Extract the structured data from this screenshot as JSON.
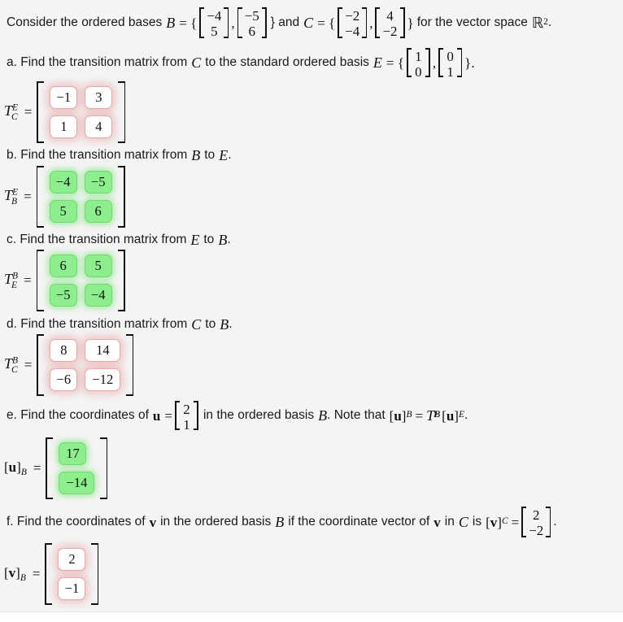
{
  "page": {
    "background_color": "#f4f4f4",
    "below_divider_color": "#ffffff",
    "correct_color": "#8cee8c",
    "incorrect_color": "#ffffff",
    "incorrect_border_color": "#e8a8a8"
  },
  "intro": {
    "text_before_B": "Consider the ordered bases",
    "B_symbol": "B",
    "equals": "= {",
    "B_vectors": [
      {
        "top": "−4",
        "bottom": "5"
      },
      {
        "top": "−5",
        "bottom": "6"
      }
    ],
    "close_and": "} and",
    "C_symbol": "C",
    "C_vectors": [
      {
        "top": "−2",
        "bottom": "−4"
      },
      {
        "top": "4",
        "bottom": "−2"
      }
    ],
    "close_brace": "}",
    "text_after": "for the vector space",
    "space_symbol": "ℝ",
    "space_exponent": "2",
    "period": "."
  },
  "parts": [
    {
      "id": "a",
      "prompt_prefix": "a. Find the transition matrix from",
      "from_symbol": "C",
      "prompt_middle": "to the standard ordered basis",
      "to_symbol": "E",
      "prompt_equals": "= {",
      "E_vectors": [
        {
          "top": "1",
          "bottom": "0"
        },
        {
          "top": "0",
          "bottom": "1"
        }
      ],
      "prompt_suffix": "}.",
      "answer_label_base": "T",
      "answer_label_sup": "E",
      "answer_label_sub": "C",
      "answer_rows": [
        [
          {
            "value": "−1",
            "state": "incorrect"
          },
          {
            "value": "3",
            "state": "incorrect"
          }
        ],
        [
          {
            "value": "1",
            "state": "incorrect"
          },
          {
            "value": "4",
            "state": "incorrect"
          }
        ]
      ]
    },
    {
      "id": "b",
      "prompt_prefix": "b. Find the transition matrix from",
      "from_symbol": "B",
      "prompt_middle": "to",
      "to_symbol": "E",
      "prompt_suffix": ".",
      "answer_label_base": "T",
      "answer_label_sup": "E",
      "answer_label_sub": "B",
      "answer_rows": [
        [
          {
            "value": "−4",
            "state": "correct"
          },
          {
            "value": "−5",
            "state": "correct"
          }
        ],
        [
          {
            "value": "5",
            "state": "correct"
          },
          {
            "value": "6",
            "state": "correct"
          }
        ]
      ]
    },
    {
      "id": "c",
      "prompt_prefix": "c. Find the transition matrix from",
      "from_symbol": "E",
      "prompt_middle": "to",
      "to_symbol": "B",
      "prompt_suffix": ".",
      "answer_label_base": "T",
      "answer_label_sup": "B",
      "answer_label_sub": "E",
      "answer_rows": [
        [
          {
            "value": "6",
            "state": "correct"
          },
          {
            "value": "5",
            "state": "correct"
          }
        ],
        [
          {
            "value": "−5",
            "state": "correct"
          },
          {
            "value": "−4",
            "state": "correct"
          }
        ]
      ]
    },
    {
      "id": "d",
      "prompt_prefix": "d. Find the transition matrix from",
      "from_symbol": "C",
      "prompt_middle": "to",
      "to_symbol": "B",
      "prompt_suffix": ".",
      "answer_label_base": "T",
      "answer_label_sup": "B",
      "answer_label_sub": "C",
      "answer_rows": [
        [
          {
            "value": "8",
            "state": "incorrect"
          },
          {
            "value": "14",
            "state": "incorrect"
          }
        ],
        [
          {
            "value": "−6",
            "state": "incorrect"
          },
          {
            "value": "−12",
            "state": "incorrect"
          }
        ]
      ]
    },
    {
      "id": "e",
      "prompt_prefix": "e. Find the coordinates of",
      "vector_symbol": "u",
      "given_vector": {
        "top": "2",
        "bottom": "1"
      },
      "prompt_middle": "in the ordered basis",
      "basis_symbol": "B",
      "note_prefix": ". Note that",
      "note_lhs_vec": "u",
      "note_lhs_sub": "B",
      "note_eq": "=",
      "note_T_base": "T",
      "note_T_sup": "B",
      "note_T_sub": "E",
      "note_rhs_vec": "u",
      "note_rhs_sub": "E",
      "note_period": ".",
      "answer_label_vec": "v_placeholder_u",
      "answer_label_bracket_vec": "u",
      "answer_label_sub": "B",
      "answer_rows": [
        [
          {
            "value": "17",
            "state": "correct"
          }
        ],
        [
          {
            "value": "−14",
            "state": "correct"
          }
        ]
      ]
    },
    {
      "id": "f",
      "prompt_prefix": "f. Find the coordinates of",
      "vector_symbol": "v",
      "prompt_middle": "in the ordered basis",
      "basis_symbol": "B",
      "prompt_condition": "if the coordinate vector of",
      "vector_symbol2": "v",
      "prompt_in": "in",
      "basis_symbol2": "C",
      "prompt_is": "is",
      "given_label_vec": "v",
      "given_label_sub": "C",
      "given_eq": "=",
      "given_vector": {
        "top": "2",
        "bottom": "−2"
      },
      "prompt_suffix": ".",
      "answer_label_bracket_vec": "v",
      "answer_label_sub": "B",
      "answer_rows": [
        [
          {
            "value": "2",
            "state": "incorrect"
          }
        ],
        [
          {
            "value": "−1",
            "state": "incorrect"
          }
        ]
      ]
    }
  ]
}
